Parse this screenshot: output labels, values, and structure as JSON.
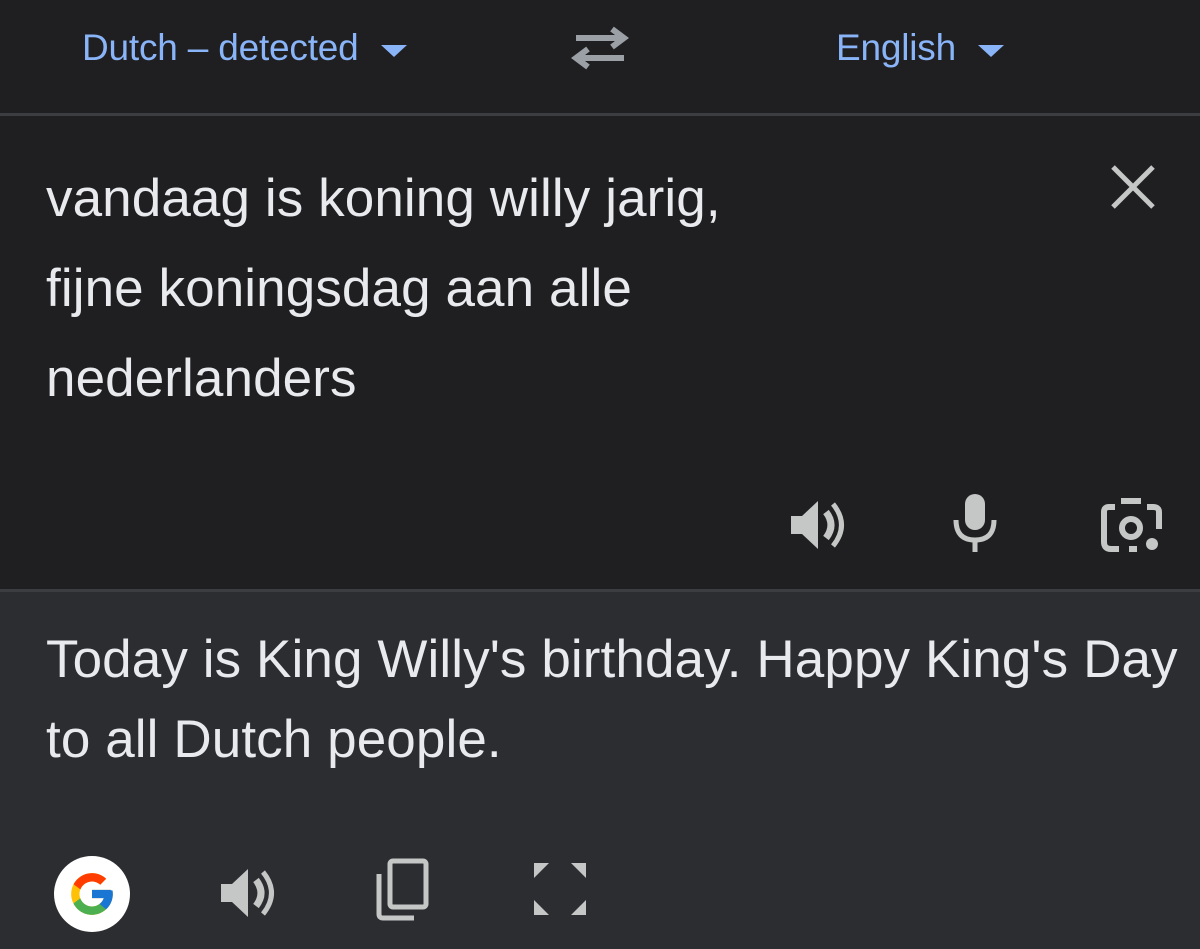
{
  "header": {
    "source_language": "Dutch – detected",
    "target_language": "English"
  },
  "source": {
    "text": "vandaag is koning willy jarig,\nfijne koningsdag aan alle\nnederlanders"
  },
  "translation": {
    "text": "Today is King Willy's birthday. Happy King's Day to all Dutch people."
  },
  "icons": {
    "swap": "swap-languages-icon",
    "clear": "close-icon",
    "source_speaker": "speaker-icon",
    "microphone": "microphone-icon",
    "camera": "camera-icon",
    "google": "google-logo",
    "target_speaker": "speaker-icon",
    "copy": "copy-icon",
    "fullscreen": "fullscreen-icon"
  },
  "colors": {
    "accent": "#8ab4f8",
    "text": "#e8eaed",
    "icon": "#c4c7c5",
    "source_bg": "#1f1f21",
    "target_bg": "#2c2d31"
  }
}
